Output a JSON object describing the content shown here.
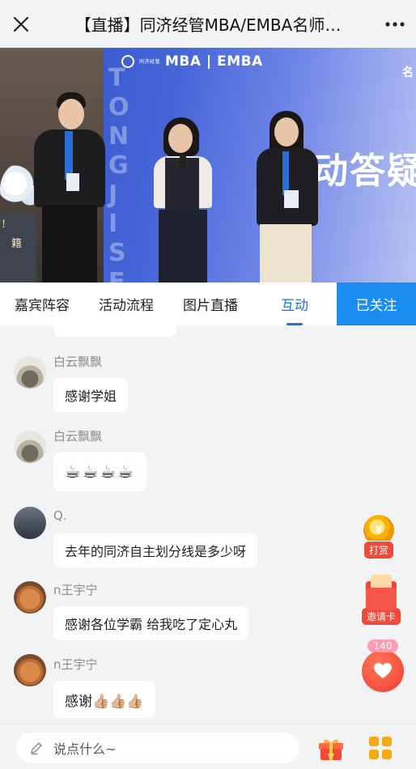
{
  "header": {
    "title": "【直播】同济经管MBA/EMBA名师…",
    "close_icon": "close-icon",
    "more_icon": "more-icon"
  },
  "video": {
    "logo_text": "MBA | EMBA",
    "logo_small": "同济经管",
    "stage_text": "动答疑",
    "corner_text": "名",
    "vertical_text": "TONGJI SEM",
    "stand_text_1": "!",
    "stand_text_2": "籍"
  },
  "tabs": [
    {
      "label": "嘉宾阵容",
      "active": false
    },
    {
      "label": "活动流程",
      "active": false
    },
    {
      "label": "图片直播",
      "active": false
    },
    {
      "label": "互动",
      "active": true
    }
  ],
  "follow_label": "已关注",
  "messages": [
    {
      "user": "白云飘飘",
      "text": "感谢学姐"
    },
    {
      "user": "白云飘飘",
      "text": "☕☕☕☕"
    },
    {
      "user": "Q.",
      "text": "去年的同济自主划分线是多少呀"
    },
    {
      "user": "n王宇宁",
      "text": "感谢各位学霸 给我吃了定心丸"
    },
    {
      "user": "n王宇宁",
      "text": "感谢👍🏼👍🏼👍🏼"
    }
  ],
  "floating": {
    "tip_label": "打赏",
    "tip_icon_glyph": "¥",
    "invite_label": "邀请卡",
    "like_count": "140"
  },
  "bottom": {
    "input_placeholder": "说点什么~"
  },
  "colors": {
    "accent": "#1a73e8",
    "follow_bg": "#1c8cf5",
    "badge_red": "#f14a3b"
  }
}
